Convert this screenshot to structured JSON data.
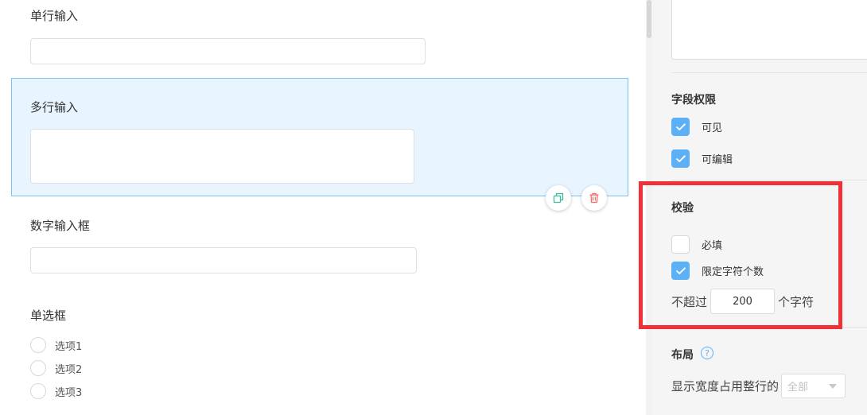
{
  "canvas": {
    "fields": {
      "single_line": {
        "label": "单行输入"
      },
      "multi_line": {
        "label": "多行输入"
      },
      "number": {
        "label": "数字输入框"
      },
      "radio": {
        "label": "单选框",
        "options": [
          "选项1",
          "选项2",
          "选项3"
        ]
      }
    },
    "actions": {
      "copy_icon": "copy-icon",
      "delete_icon": "trash-icon"
    }
  },
  "panel": {
    "permission": {
      "title": "字段权限",
      "items": [
        {
          "label": "可见",
          "checked": true
        },
        {
          "label": "可编辑",
          "checked": true
        }
      ]
    },
    "validation": {
      "title": "校验",
      "required": {
        "label": "必填",
        "checked": false
      },
      "limit": {
        "label": "限定字符个数",
        "checked": true
      },
      "max_prefix": "不超过",
      "max_value": "200",
      "max_suffix": "个字符"
    },
    "layout": {
      "title": "布局",
      "help_icon": "question-circle-icon",
      "width_label": "显示宽度占用整行的",
      "width_value": "全部"
    }
  },
  "colors": {
    "accent": "#5cb1f6",
    "selected_bg": "#e8f4fe",
    "highlight": "#ee3237",
    "delete": "#f56c6c",
    "copy": "#3bbd9a"
  }
}
